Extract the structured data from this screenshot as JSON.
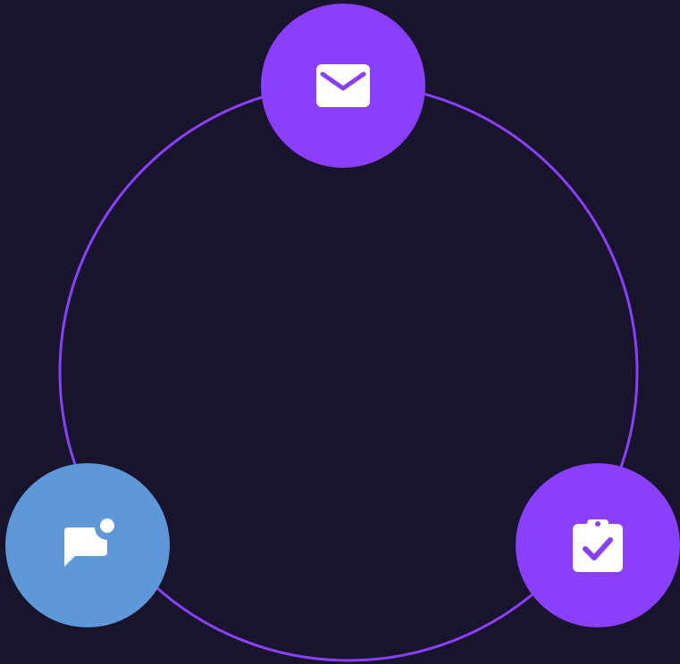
{
  "theme": {
    "background": "#17142b",
    "ring": "#8a3ffc",
    "accent_purple": "#8a3ffc",
    "accent_blue": "#5e98d9",
    "icon_fill": "#ffffff"
  },
  "nodes": [
    {
      "id": "email",
      "icon": "envelope-icon",
      "color": "#8a3ffc"
    },
    {
      "id": "chat",
      "icon": "chat-notification-icon",
      "color": "#5e98d9"
    },
    {
      "id": "tasks",
      "icon": "clipboard-check-icon",
      "color": "#8a3ffc"
    }
  ]
}
